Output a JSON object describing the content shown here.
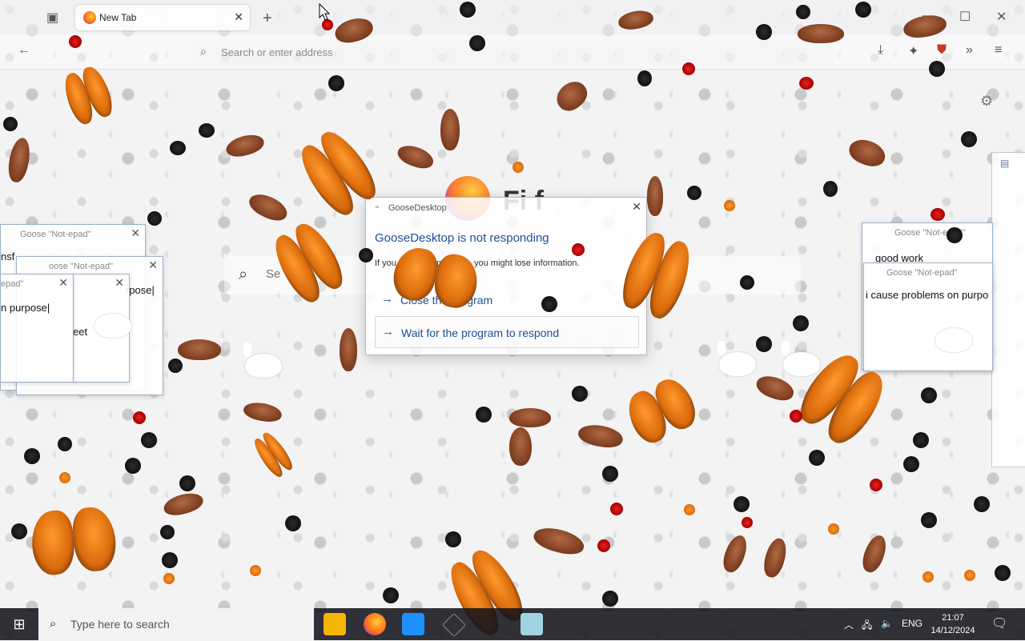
{
  "browser": {
    "tab_title": "New Tab",
    "url_placeholder": "Search or enter address",
    "newtab_search_placeholder": "Se",
    "logo_word": "Fi f"
  },
  "dialog": {
    "caption": "GooseDesktop",
    "heading": "GooseDesktop is not responding",
    "body": "If you close the program, you might lose information.",
    "option1": "Close the program",
    "option2": "Wait for the program to respond"
  },
  "notepads": {
    "left1_title": "Goose \"Not-epad\"",
    "left1_text": "nsf",
    "left2_title": "oose \"Not-epad\"",
    "left2_text": "rpose|",
    "left3_title": "epad\"",
    "left3_text": "n purpose|",
    "left4_text": "eet",
    "right1_title": "Goose \"Not-epad\"",
    "right1_text": "good work",
    "right2_title": "Goose \"Not-epad\"",
    "right2_text": "i cause problems on purpo"
  },
  "taskbar": {
    "search_placeholder": "Type here to search",
    "lang": "ENG",
    "time": "21:07",
    "date": "14/12/2024"
  }
}
